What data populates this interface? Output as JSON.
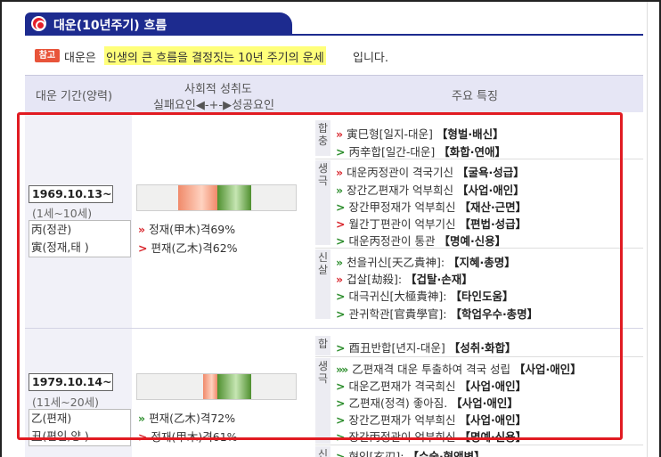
{
  "title": "대운(10년주기) 흐름",
  "note": {
    "badge": "참고",
    "pre": "대운은",
    "highlight": "인생의 큰 흐름을 결정짓는 10년 주기의 운세",
    "post": "입니다."
  },
  "header": {
    "period": "대운 기간(양력)",
    "social": "사회적 성취도",
    "scale": "실패요인◀-+-▶성공요인",
    "feature": "주요 특징"
  },
  "rows": [
    {
      "date": "1969.10.13~",
      "age": "(1세~10세)",
      "stem": "丙(정관)",
      "branch": "寅(정재,태 )",
      "captions": [
        {
          "arrow": "»",
          "tone": "red",
          "text": "정재(甲木)격69%"
        },
        {
          "arrow": ">",
          "tone": "red",
          "text": "편재(乙木)격62%"
        }
      ],
      "groups": [
        {
          "label": "합충",
          "items": [
            {
              "arrow": "»",
              "tone": "red",
              "text": "寅巳형[일지-대운] ",
              "tag": "【형벌·배신】"
            },
            {
              "arrow": ">",
              "tone": "green",
              "text": "丙辛합[일간-대운] ",
              "tag": "【화합·연애】"
            }
          ]
        },
        {
          "label": "생극",
          "items": [
            {
              "arrow": "»",
              "tone": "red",
              "text": "대운丙정관이 격국기신 ",
              "tag": "【굴욕·성급】"
            },
            {
              "arrow": "»",
              "tone": "green",
              "text": "장간乙편재가 억부희신 ",
              "tag": "【사업·애인】"
            },
            {
              "arrow": ">",
              "tone": "green",
              "text": "장간甲정재가 억부희신 ",
              "tag": "【재산·근면】"
            },
            {
              "arrow": ">",
              "tone": "red",
              "text": "월간丁편관이 억부기신 ",
              "tag": "【편법·성급】"
            },
            {
              "arrow": ">",
              "tone": "green",
              "text": "대운丙정관이 통관 ",
              "tag": "【명예·신용】"
            }
          ]
        },
        {
          "label": "신살",
          "items": [
            {
              "arrow": "»",
              "tone": "green",
              "text": "천을귀신[天乙貴神]: ",
              "tag": "【지혜·총명】"
            },
            {
              "arrow": "»",
              "tone": "red",
              "text": "겁살[劫殺]: ",
              "tag": "【겁탈·손재】"
            },
            {
              "arrow": ">",
              "tone": "green",
              "text": "대극귀신[大極貴神]: ",
              "tag": "【타인도움】"
            },
            {
              "arrow": ">",
              "tone": "green",
              "text": "관귀학관[官貴學官]: ",
              "tag": "【학업우수·총명】"
            }
          ]
        }
      ]
    },
    {
      "date": "1979.10.14~",
      "age": "(11세~20세)",
      "stem": "乙(편재)",
      "branch": "丑(편인,양 )",
      "captions": [
        {
          "arrow": "»",
          "tone": "green",
          "text": "편재(乙木)격72%"
        },
        {
          "arrow": ">",
          "tone": "red",
          "text": "정재(甲木)격61%"
        }
      ],
      "groups": [
        {
          "label": "합",
          "items": [
            {
              "arrow": ">",
              "tone": "green",
              "text": "酉丑반합[년지-대운] ",
              "tag": "【성취·화합】"
            }
          ]
        },
        {
          "label": "생극",
          "items": [
            {
              "arrow": "»»",
              "tone": "green",
              "text": "乙편재격 대운 투출하여 격국 성립 ",
              "tag": "【사업·애인】"
            },
            {
              "arrow": ">",
              "tone": "green",
              "text": "대운乙편재가 격국희신 ",
              "tag": "【사업·애인】"
            },
            {
              "arrow": ">",
              "tone": "green",
              "text": "乙편재(정격) 좋아짐. ",
              "tag": "【사업·애인】"
            },
            {
              "arrow": ">",
              "tone": "green",
              "text": "장간乙편재가 억부희신 ",
              "tag": "【사업·애인】"
            },
            {
              "arrow": ">",
              "tone": "green",
              "text": "장간丙정관이 억부희신 ",
              "tag": "【명예·신용】"
            }
          ]
        },
        {
          "label": "신",
          "items": [
            {
              "arrow": ">",
              "tone": "green",
              "text": "현인[玄刃]: ",
              "tag": "【수술·형액변】"
            }
          ]
        }
      ]
    }
  ],
  "colors": {
    "title_bg": "#1d2b8f",
    "header_bg": "#e6e6f5",
    "highlight": "#ffff7a",
    "outline": "#e11b22",
    "negative": "#f08a6a",
    "positive": "#4f8f2f"
  }
}
